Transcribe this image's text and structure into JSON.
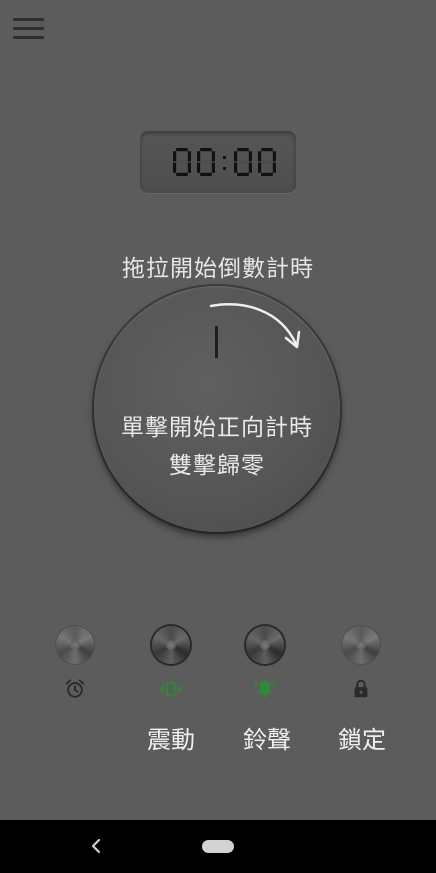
{
  "timer": {
    "display": "00:00"
  },
  "hints": {
    "drag": "拖拉開始倒數計時",
    "tap": "單擊開始正向計時",
    "double_tap": "雙擊歸零"
  },
  "controls": [
    {
      "icon": "alarm-clock-icon",
      "label": "",
      "active": false
    },
    {
      "icon": "vibrate-icon",
      "label": "震動",
      "active": true
    },
    {
      "icon": "bell-ring-icon",
      "label": "鈴聲",
      "active": true
    },
    {
      "icon": "lock-icon",
      "label": "鎖定",
      "active": false
    }
  ],
  "colors": {
    "background": "#5c5c5c",
    "active_icon": "#2e8a35",
    "inactive_icon": "#2a2a2a",
    "text": "#e6e6e6"
  }
}
